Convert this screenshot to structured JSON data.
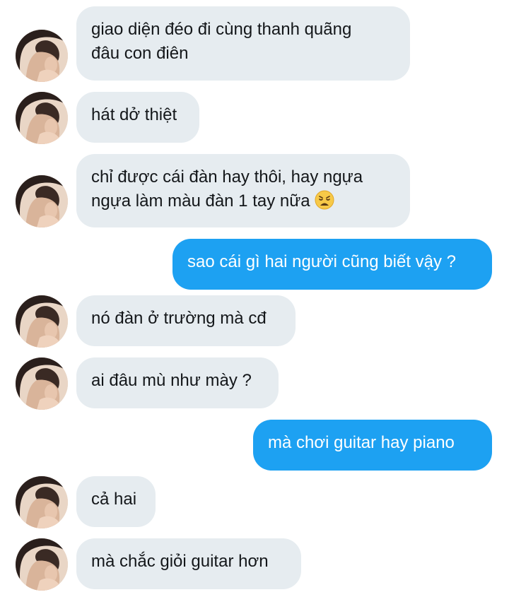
{
  "conversation": {
    "messages": [
      {
        "direction": "incoming",
        "avatar": "contact-avatar",
        "text": "giao diện đéo đi cùng thanh quãng\nđâu con điên"
      },
      {
        "direction": "incoming",
        "avatar": "contact-avatar",
        "text": "hát dở thiệt"
      },
      {
        "direction": "incoming",
        "avatar": "contact-avatar",
        "text": "chỉ được cái đàn hay thôi, hay ngựa\nngựa làm màu đàn 1 tay nữa",
        "emoji": "weary-face-emoji"
      },
      {
        "direction": "outgoing",
        "text": "sao cái gì hai người cũng biết vậy ?"
      },
      {
        "direction": "incoming",
        "avatar": "contact-avatar",
        "text": "nó đàn ở trường mà cđ"
      },
      {
        "direction": "incoming",
        "avatar": "contact-avatar",
        "text": "ai đâu mù như mày ?"
      },
      {
        "direction": "outgoing",
        "text": "mà chơi guitar hay piano"
      },
      {
        "direction": "incoming",
        "avatar": "contact-avatar",
        "text": "cả hai"
      },
      {
        "direction": "incoming",
        "avatar": "contact-avatar",
        "text": "mà chắc giỏi guitar hơn"
      }
    ]
  },
  "colors": {
    "incoming_bubble": "#e6ecf0",
    "outgoing_bubble": "#1da1f2",
    "incoming_text": "#14171a",
    "outgoing_text": "#ffffff",
    "background": "#ffffff"
  }
}
